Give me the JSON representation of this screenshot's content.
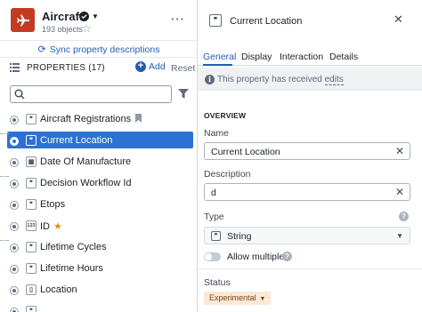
{
  "object": {
    "title": "Aircraft",
    "objects_count": "193 objects",
    "brand_color": "#c23b22"
  },
  "sync_label": "Sync property descriptions",
  "properties": {
    "header": "PROPERTIES (17)",
    "add_label": "Add",
    "reset_label": "Reset",
    "search_placeholder": "",
    "items": [
      {
        "label": "Aircraft Registrations",
        "type_icon": "quote-string-icon",
        "extra": "bookmark-icon"
      },
      {
        "label": "Current Location",
        "type_icon": "quote-string-icon",
        "selected": true
      },
      {
        "label": "Date Of Manufacture",
        "type_icon": "calendar-icon"
      },
      {
        "label": "Decision Workflow Id",
        "type_icon": "quote-string-icon"
      },
      {
        "label": "Etops",
        "type_icon": "quote-string-icon"
      },
      {
        "label": "ID",
        "type_icon": "id-number-icon",
        "extra": "star-icon"
      },
      {
        "label": "Lifetime Cycles",
        "type_icon": "quote-string-icon"
      },
      {
        "label": "Lifetime Hours",
        "type_icon": "quote-string-icon"
      },
      {
        "label": "Location",
        "type_icon": "document-icon"
      }
    ]
  },
  "detail": {
    "title": "Current Location",
    "tabs": [
      "General",
      "Display",
      "Interaction",
      "Details"
    ],
    "active_tab": "General",
    "notice_prefix": "This property has received ",
    "notice_link": "edits",
    "section": "OVERVIEW",
    "name_label": "Name",
    "name_value": "Current Location",
    "description_label": "Description",
    "description_value": "d",
    "type_label": "Type",
    "type_value": "String",
    "allow_multiple_label": "Allow multiple",
    "allow_multiple": false,
    "status_label": "Status",
    "status_value": "Experimental"
  },
  "colors": {
    "accent": "#2d72d2",
    "link": "#215db0",
    "status_bg": "#fbe8d8"
  }
}
